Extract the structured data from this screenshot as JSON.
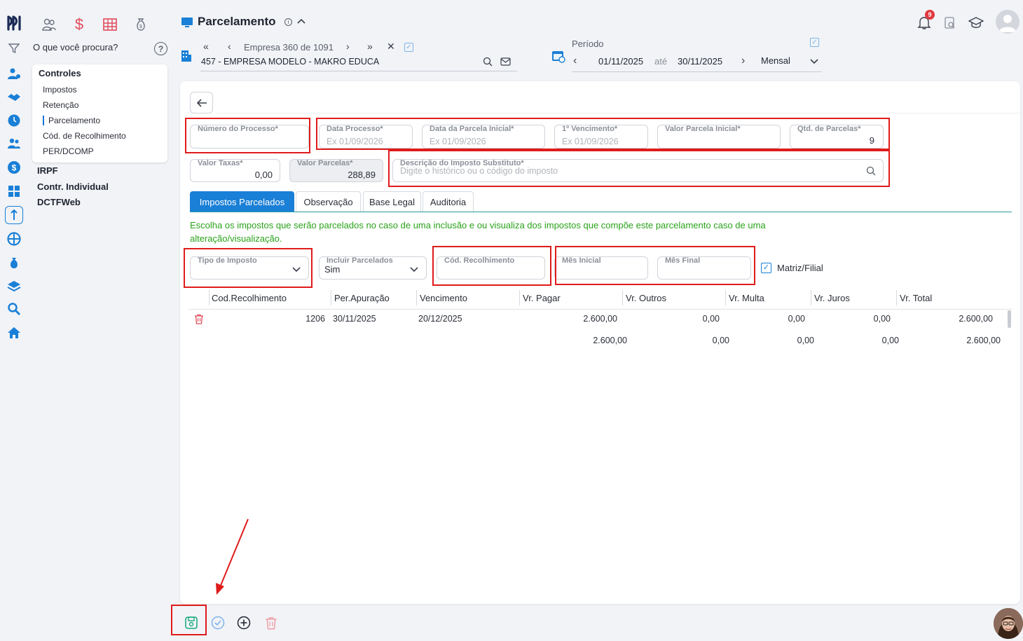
{
  "header": {
    "title": "Parcelamento",
    "search_placeholder": "O que você procura?",
    "notification_count": "9"
  },
  "company": {
    "nav_text": "Empresa 360 de 1091",
    "name": "457 - EMPRESA MODELO - MAKRO EDUCA"
  },
  "period": {
    "label": "Período",
    "from": "01/11/2025",
    "until_label": "até",
    "to": "30/11/2025",
    "frequency": "Mensal"
  },
  "sidebar": {
    "section_title": "Controles",
    "items": [
      "Impostos",
      "Retenção",
      "Parcelamento",
      "Cód. de Recolhimento",
      "PER/DCOMP"
    ],
    "links": [
      "IRPF",
      "Contr. Individual",
      "DCTFWeb"
    ]
  },
  "form": {
    "numero_processo": {
      "label": "Número do Processo*",
      "value": ""
    },
    "data_processo": {
      "label": "Data Processo*",
      "placeholder": "Ex 01/09/2026"
    },
    "data_parcela_inicial": {
      "label": "Data da Parcela Inicial*",
      "placeholder": "Ex 01/09/2026"
    },
    "primeiro_vencimento": {
      "label": "1º Vencimento*",
      "placeholder": "Ex 01/09/2026"
    },
    "valor_parcela_inicial": {
      "label": "Valor Parcela Inicial*",
      "value": ""
    },
    "qtd_parcelas": {
      "label": "Qtd. de Parcelas*",
      "value": "9"
    },
    "valor_taxas": {
      "label": "Valor Taxas*",
      "value": "0,00"
    },
    "valor_parcelas": {
      "label": "Valor Parcelas*",
      "value": "288,89"
    },
    "descricao_imposto": {
      "label": "Descrição do Imposto Substituto*",
      "placeholder": "Digite o histórico ou o código do imposto"
    }
  },
  "tabs": [
    "Impostos Parcelados",
    "Observação",
    "Base Legal",
    "Auditoria"
  ],
  "info_text_line1": "Escolha os impostos que serão parcelados no caso de uma inclusão e ou visualiza dos impostos que compõe este parcelamento caso de uma",
  "info_text_line2": "alteração/visualização.",
  "filters": {
    "tipo_imposto": {
      "label": "Tipo de Imposto",
      "value": ""
    },
    "incluir_parcelados": {
      "label": "Incluir Parcelados",
      "value": "Sim"
    },
    "cod_recolhimento": {
      "label": "Cód. Recolhimento",
      "value": ""
    },
    "mes_inicial": {
      "label": "Mês Inicial",
      "value": ""
    },
    "mes_final": {
      "label": "Mês Final",
      "value": ""
    },
    "matriz_filial": {
      "label": "Matriz/Filial",
      "checked": true
    }
  },
  "table": {
    "columns": [
      "Cod.Recolhimento",
      "Per.Apuração",
      "Vencimento",
      "Vr. Pagar",
      "Vr. Outros",
      "Vr. Multa",
      "Vr. Juros",
      "Vr. Total"
    ],
    "rows": [
      {
        "cod": "1206",
        "per": "30/11/2025",
        "venc": "20/12/2025",
        "pagar": "2.600,00",
        "outros": "0,00",
        "multa": "0,00",
        "juros": "0,00",
        "total": "2.600,00"
      }
    ],
    "totals": {
      "pagar": "2.600,00",
      "outros": "0,00",
      "multa": "0,00",
      "juros": "0,00",
      "total": "2.600,00"
    }
  },
  "colors": {
    "accent": "#1a7fd6",
    "highlight": "#e01b1b",
    "info_text": "#2aa21a"
  }
}
